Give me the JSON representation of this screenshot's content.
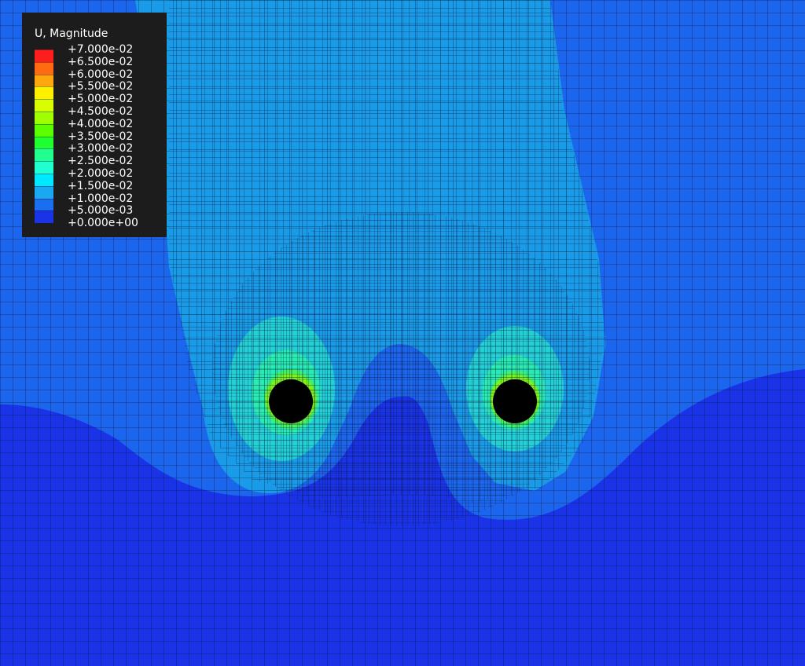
{
  "legend": {
    "title": "U, Magnitude",
    "labels": [
      "+7.000e-02",
      "+6.500e-02",
      "+6.000e-02",
      "+5.500e-02",
      "+5.000e-02",
      "+4.500e-02",
      "+4.000e-02",
      "+3.500e-02",
      "+3.000e-02",
      "+2.500e-02",
      "+2.000e-02",
      "+1.500e-02",
      "+1.000e-02",
      "+5.000e-03",
      "+0.000e+00"
    ],
    "colors": [
      "#ff1e1e",
      "#ff6a12",
      "#ffa70f",
      "#fff000",
      "#d8ff00",
      "#a0ff00",
      "#5cff00",
      "#20ff30",
      "#20ff8f",
      "#20ffcf",
      "#00e8ff",
      "#1aa8f0",
      "#1a6ef0",
      "#1a33e6"
    ]
  },
  "contour_colors": {
    "band_0_to_5e-03": "#1a33e6",
    "band_5e-03_to_1e-02": "#1c66ee",
    "band_1e-02_to_1_5e-02": "#1a9be8",
    "band_1_5e-02_to_2e-02": "#22d0d6",
    "band_2e-02_to_2_5e-02": "#28ecb2",
    "band_2_5e-02_to_3e-02": "#45f062",
    "band_3e-02_to_4e-02": "#7cf21c",
    "hole": "#000000",
    "mesh_line": "#0a1030"
  }
}
